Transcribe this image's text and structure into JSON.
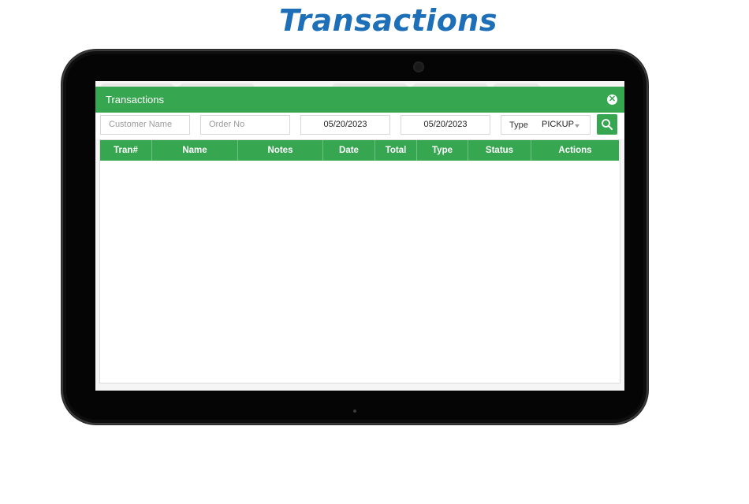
{
  "page_heading": "Transactions",
  "modal": {
    "title": "Transactions",
    "close_icon": "close-circle-icon"
  },
  "filters": {
    "customer_name_placeholder": "Customer Name",
    "order_no_placeholder": "Order No",
    "date_from": "05/20/2023",
    "date_to": "05/20/2023",
    "type_label": "Type",
    "type_value": "PICKUP",
    "search_icon": "search-icon"
  },
  "table": {
    "columns": [
      "Tran#",
      "Name",
      "Notes",
      "Date",
      "Total",
      "Type",
      "Status",
      "Actions"
    ],
    "rows": []
  },
  "colors": {
    "accent": "#37a651",
    "heading": "#1d6fb8"
  }
}
